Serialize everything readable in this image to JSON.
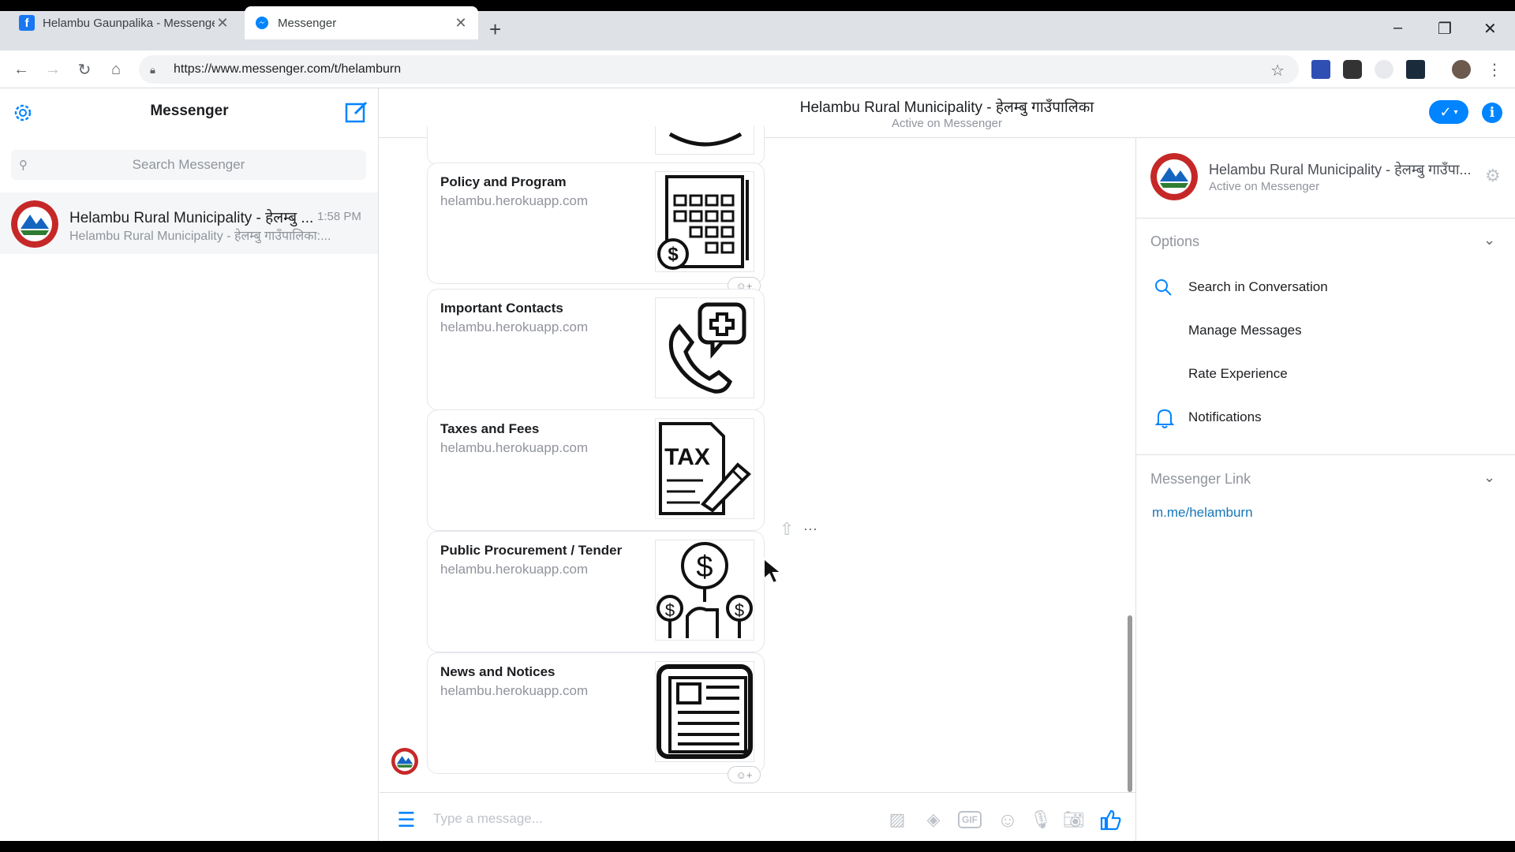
{
  "browser": {
    "tabs": [
      {
        "title": "Helambu Gaunpalika - Messenger",
        "active": false
      },
      {
        "title": "Messenger",
        "active": true
      }
    ],
    "new_tab_icon": "plus-icon",
    "url": "https://www.messenger.com/t/helamburn",
    "window_controls": {
      "minimize": "–",
      "maximize": "❐",
      "close": "✕"
    }
  },
  "sidebar": {
    "title": "Messenger",
    "search_placeholder": "Search Messenger",
    "conversations": [
      {
        "name": "Helambu Rural Municipality - हेलम्बु ...",
        "time": "1:58 PM",
        "snippet": "Helambu Rural Municipality - हेलम्बु गाउँपालिका:..."
      }
    ]
  },
  "chat_header": {
    "name": "Helambu Rural Municipality - हेलम्बु गाउँपालिका",
    "status": "Active on Messenger"
  },
  "cards": [
    {
      "title": "Policy and Program",
      "subtitle": "helambu.herokuapp.com",
      "icon": "calculator-icon"
    },
    {
      "title": "Important Contacts",
      "subtitle": "helambu.herokuapp.com",
      "icon": "phone-medical-icon"
    },
    {
      "title": "Taxes and Fees",
      "subtitle": "helambu.herokuapp.com",
      "icon": "tax-document-icon"
    },
    {
      "title": "Public Procurement / Tender",
      "subtitle": "helambu.herokuapp.com",
      "icon": "tender-money-icon"
    },
    {
      "title": "News and Notices",
      "subtitle": "helambu.herokuapp.com",
      "icon": "newspaper-icon"
    }
  ],
  "composer": {
    "placeholder": "Type a message...",
    "gif_label": "GIF"
  },
  "right_panel": {
    "name": "Helambu Rural Municipality - हेलम्बु गाउँपा...",
    "status": "Active on Messenger",
    "options_label": "Options",
    "options": [
      "Search in Conversation",
      "Manage Messages",
      "Rate Experience",
      "Notifications"
    ],
    "messenger_link_label": "Messenger Link",
    "messenger_link": "m.me/helamburn"
  },
  "colors": {
    "messenger_blue": "#0084ff",
    "link_blue": "#1877b8",
    "muted_text": "#90949c"
  }
}
